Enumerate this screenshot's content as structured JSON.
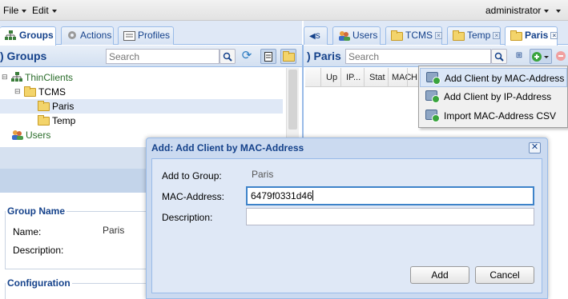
{
  "menubar": {
    "file": "File",
    "edit": "Edit",
    "user": "administrator"
  },
  "left_tabs": [
    {
      "label": "Groups",
      "icon": "groups-icon"
    },
    {
      "label": "Actions",
      "icon": "gear-icon"
    },
    {
      "label": "Profiles",
      "icon": "profile-icon"
    }
  ],
  "right_tabs": [
    {
      "label": "s"
    },
    {
      "label": "Users"
    },
    {
      "label": "TCMS"
    },
    {
      "label": "Temp"
    },
    {
      "label": "Paris"
    }
  ],
  "left_panel": {
    "title": ") Groups",
    "search_placeholder": "Search"
  },
  "right_panel": {
    "title": ") Paris",
    "search_placeholder": "Search"
  },
  "tree": [
    {
      "label": "ThinClients",
      "icon": "network-icon"
    },
    {
      "label": "TCMS",
      "icon": "folder-icon"
    },
    {
      "label": "Paris",
      "icon": "folder-icon",
      "selected": true
    },
    {
      "label": "Temp",
      "icon": "folder-icon"
    },
    {
      "label": "Users",
      "icon": "users-icon"
    }
  ],
  "grid_columns": [
    "Up",
    "IP...",
    "Stat",
    "MAC",
    "H"
  ],
  "add_menu": [
    "Add Client by MAC-Address",
    "Add Client by IP-Address",
    "Import MAC-Address CSV"
  ],
  "group_section": {
    "legend": "Group Name",
    "name_label": "Name:",
    "name_value": "Paris",
    "description_label": "Description:"
  },
  "configuration_legend": "Configuration",
  "dialog": {
    "title": "Add: Add Client by MAC-Address",
    "group_label": "Add to Group:",
    "group_value": "Paris",
    "mac_label": "MAC-Address:",
    "mac_value": "6479f0331d46",
    "description_label": "Description:",
    "description_value": "",
    "add_button": "Add",
    "cancel_button": "Cancel"
  },
  "colors": {
    "accent": "#15428b",
    "panel": "#dfe8f6",
    "border": "#99bbe8",
    "focus": "#3e83c9"
  }
}
